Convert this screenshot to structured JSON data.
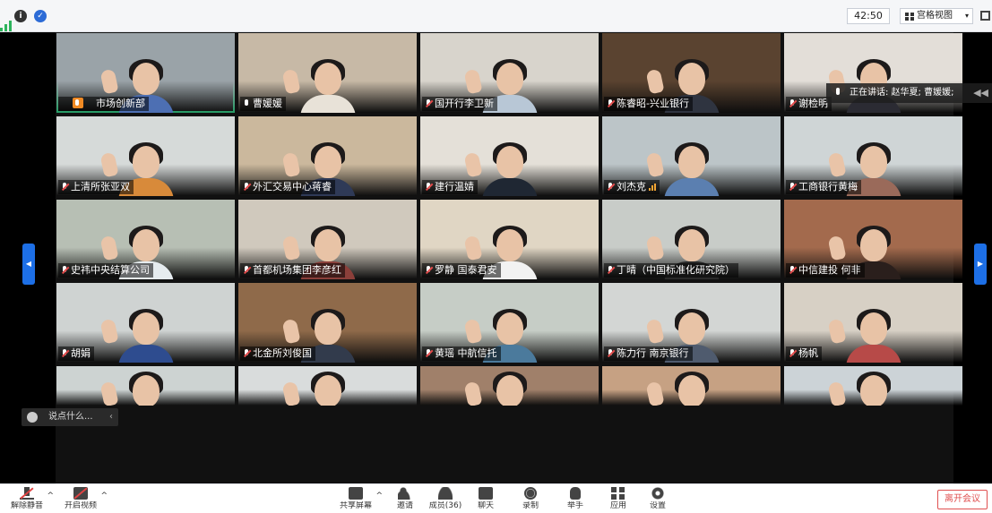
{
  "topbar": {
    "timer": "42:50",
    "view_label": "宫格视图"
  },
  "speaking": {
    "text": "正在讲话: 赵华夏; 曹媛媛;"
  },
  "chat": {
    "placeholder": "说点什么..."
  },
  "tiles": [
    {
      "name": "市场创新部",
      "host": true,
      "mic_on": true,
      "bg": "#9aa3a8",
      "shirt": "#4d6fb3"
    },
    {
      "name": "曹媛媛",
      "mic_on": true,
      "bg": "#c7b9a6",
      "shirt": "#e8e2d8"
    },
    {
      "name": "国开行李卫新",
      "bg": "#d8d4cc",
      "shirt": "#b8c7d6"
    },
    {
      "name": "陈睿昭-兴业银行",
      "bg": "#5a4330",
      "shirt": "#2f3440"
    },
    {
      "name": "谢检明",
      "bg": "#e3ded8",
      "shirt": "#2b2b33"
    },
    {
      "name": "上清所张亚双",
      "bg": "#d6dad9",
      "shirt": "#d88a3a"
    },
    {
      "name": "外汇交易中心蒋睿",
      "bg": "#cbb89d",
      "shirt": "#2f3a57"
    },
    {
      "name": "建行温婧",
      "bg": "#e4e0d8",
      "shirt": "#1f2733"
    },
    {
      "name": "刘杰克",
      "volume": true,
      "bg": "#bcc5c8",
      "shirt": "#5b7fb0"
    },
    {
      "name": "工商银行黄梅",
      "bg": "#cfd5d6",
      "shirt": "#9a6a5a"
    },
    {
      "name": "史祎中央结算公司",
      "bg": "#b7bfb4",
      "shirt": "#e6ecef"
    },
    {
      "name": "首都机场集团李彦红",
      "bg": "#d0c9bd",
      "shirt": "#8b3f3a"
    },
    {
      "name": "罗静 国泰君安",
      "bg": "#e0d6c4",
      "shirt": "#f2f2f2"
    },
    {
      "name": "丁晴（中国标准化研究院）",
      "bg": "#c8ccc8",
      "shirt": "#2a2a2a"
    },
    {
      "name": "中信建投 何非",
      "bg": "#a36a4d",
      "shirt": "#2a1f1c"
    },
    {
      "name": "胡娟",
      "bg": "#cfd3d2",
      "shirt": "#2e4c8f"
    },
    {
      "name": "北金所刘俊国",
      "bg": "#8f6a4a",
      "shirt": "#323b4c"
    },
    {
      "name": "黄瑶 中航信托",
      "bg": "#c6cdc6",
      "shirt": "#4b7a9c"
    },
    {
      "name": "陈力行 南京银行",
      "bg": "#d3d6d4",
      "shirt": "#4f5b6e"
    },
    {
      "name": "杨帆",
      "bg": "#d7d0c5",
      "shirt": "#b74a48"
    },
    {
      "name": "",
      "bg": "#cdd3d2",
      "shirt": "#2e6bb0"
    },
    {
      "name": "",
      "bg": "#d9dcdc",
      "shirt": "#2d3444"
    },
    {
      "name": "",
      "bg": "#a0806a",
      "shirt": "#3a3a3a"
    },
    {
      "name": "",
      "bg": "#c6a183",
      "shirt": "#d8d1c8"
    },
    {
      "name": "",
      "bg": "#ccd3d7",
      "shirt": "#3b3b3b"
    }
  ],
  "toolbar": {
    "unmute": "解除静音",
    "start_video": "开启视频",
    "share": "共享屏幕",
    "invite": "邀请",
    "members": "成员(36)",
    "chat": "聊天",
    "record": "录制",
    "raise_hand": "举手",
    "apps": "应用",
    "settings": "设置",
    "leave": "离开会议"
  }
}
